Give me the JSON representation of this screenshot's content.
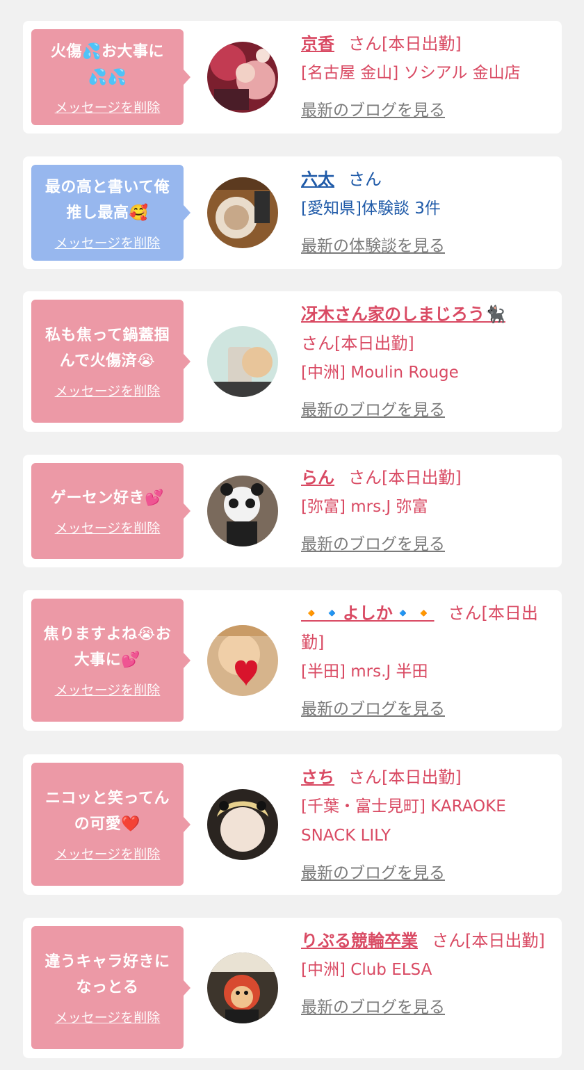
{
  "cards": [
    {
      "message": "火傷💦お大事に💦💦",
      "delete_label": "メッセージを削除",
      "name": "京香",
      "suffix": "さん[本日出勤]",
      "location": "[名古屋 金山] ソシアル 金山店",
      "blog_link": "最新のブログを見る"
    },
    {
      "message": "最の高と書いて俺推し最高🥰",
      "delete_label": "メッセージを削除",
      "name": "六太",
      "suffix": "さん",
      "location": "[愛知県]体験談 3件",
      "blog_link": "最新の体験談を見る"
    },
    {
      "message": "私も焦って鍋蓋掴んで火傷済😭",
      "delete_label": "メッセージを削除",
      "name": "冴木さん家のしまじろう🐈‍⬛",
      "suffix": "さん[本日出勤]",
      "location": "[中洲] Moulin Rouge",
      "blog_link": "最新のブログを見る"
    },
    {
      "message": "ゲーセン好き💕",
      "delete_label": "メッセージを削除",
      "name": "らん",
      "suffix": "さん[本日出勤]",
      "location": "[弥富] mrs.J 弥富",
      "blog_link": "最新のブログを見る"
    },
    {
      "message": "焦りますよね😭お大事に💕",
      "delete_label": "メッセージを削除",
      "name": "🔸🔹よしか🔹🔸",
      "suffix": "さん[本日出勤]",
      "location": "[半田] mrs.J 半田",
      "blog_link": "最新のブログを見る"
    },
    {
      "message": "ニコッと笑ってんの可愛❤️",
      "delete_label": "メッセージを削除",
      "name": "さち",
      "suffix": "さん[本日出勤]",
      "location": "[千葉・富士見町] KARAOKE SNACK LILY",
      "blog_link": "最新のブログを見る"
    },
    {
      "message": "違うキャラ好きになっとる",
      "delete_label": "メッセージを削除",
      "name": "りぷる競輪卒業",
      "suffix": "さん[本日出勤]",
      "location": "[中洲] Club ELSA",
      "blog_link": "最新のブログを見る"
    }
  ],
  "colors": {
    "pink_bubble": "#ec99a6",
    "blue_bubble": "#97b7ee",
    "cast_text": "#d94a63",
    "user_text": "#1f5aa8",
    "link_gray": "#7b7b7b"
  }
}
